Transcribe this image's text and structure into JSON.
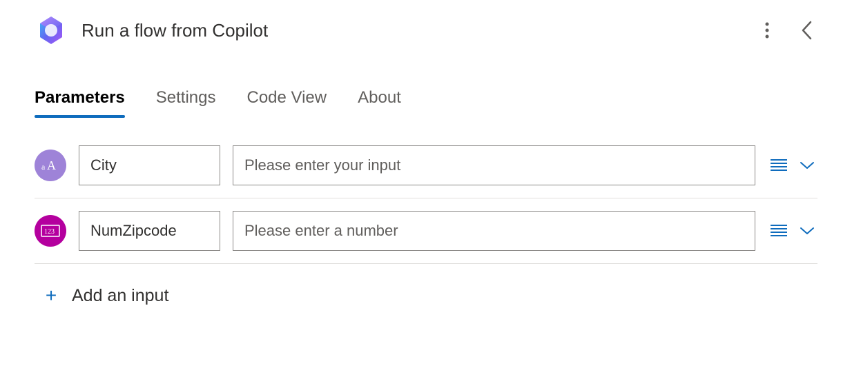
{
  "header": {
    "title": "Run a flow from Copilot"
  },
  "tabs": [
    {
      "label": "Parameters",
      "active": true
    },
    {
      "label": "Settings",
      "active": false
    },
    {
      "label": "Code View",
      "active": false
    },
    {
      "label": "About",
      "active": false
    }
  ],
  "parameters": [
    {
      "type": "text",
      "type_label": "aA",
      "type_color": "#9e83d8",
      "name": "City",
      "placeholder": "Please enter your input"
    },
    {
      "type": "number",
      "type_label": "123",
      "type_color": "#b4009e",
      "name": "NumZipcode",
      "placeholder": "Please enter a number"
    }
  ],
  "add_input_label": "Add an input"
}
